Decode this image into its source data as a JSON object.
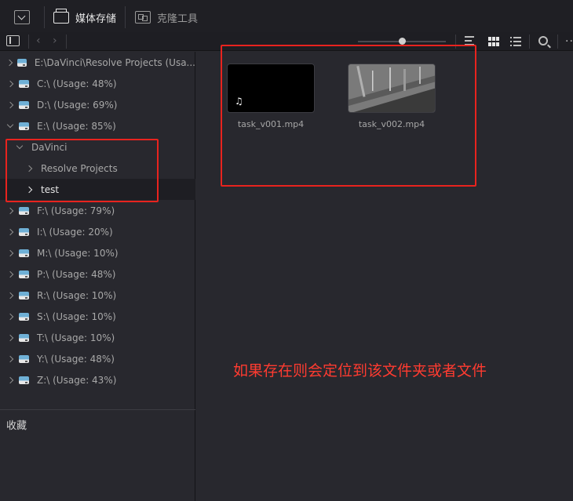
{
  "toolbar": {
    "media_storage_label": "媒体存储",
    "clone_tool_label": "克隆工具"
  },
  "sidebar": {
    "items": [
      {
        "label": "E:\\DaVinci\\Resolve Projects (Usa...",
        "expanded": false,
        "icon": "drive-icon"
      },
      {
        "label": "C:\\ (Usage: 48%)",
        "expanded": false,
        "icon": "drive-icon"
      },
      {
        "label": "D:\\ (Usage: 69%)",
        "expanded": false,
        "icon": "drive-icon"
      },
      {
        "label": "E:\\ (Usage: 85%)",
        "expanded": true,
        "icon": "drive-icon"
      },
      {
        "label": "DaVinci",
        "expanded": true,
        "icon": "none"
      },
      {
        "label": "Resolve Projects",
        "expanded": false,
        "icon": "none"
      },
      {
        "label": "test",
        "expanded": false,
        "icon": "none",
        "selected": true
      },
      {
        "label": "F:\\ (Usage: 79%)",
        "expanded": false,
        "icon": "drive-icon"
      },
      {
        "label": "I:\\ (Usage: 20%)",
        "expanded": false,
        "icon": "drive-icon"
      },
      {
        "label": "M:\\ (Usage: 10%)",
        "expanded": false,
        "icon": "drive-icon"
      },
      {
        "label": "P:\\ (Usage: 48%)",
        "expanded": false,
        "icon": "drive-icon"
      },
      {
        "label": "R:\\ (Usage: 10%)",
        "expanded": false,
        "icon": "drive-icon"
      },
      {
        "label": "S:\\ (Usage: 10%)",
        "expanded": false,
        "icon": "drive-icon"
      },
      {
        "label": "T:\\ (Usage: 10%)",
        "expanded": false,
        "icon": "drive-icon"
      },
      {
        "label": "Y:\\ (Usage: 48%)",
        "expanded": false,
        "icon": "drive-icon"
      },
      {
        "label": "Z:\\ (Usage: 43%)",
        "expanded": false,
        "icon": "drive-icon"
      }
    ],
    "favorites_label": "收藏"
  },
  "viewer": {
    "clips": [
      {
        "name": "task_v001.mp4",
        "thumbnail": "audio-black"
      },
      {
        "name": "task_v002.mp4",
        "thumbnail": "grey-frame"
      }
    ],
    "zoom_fraction": 0.5
  },
  "annotation": {
    "text": "如果存在则会定位到该文件夹或者文件",
    "color": "#ff3b30"
  }
}
